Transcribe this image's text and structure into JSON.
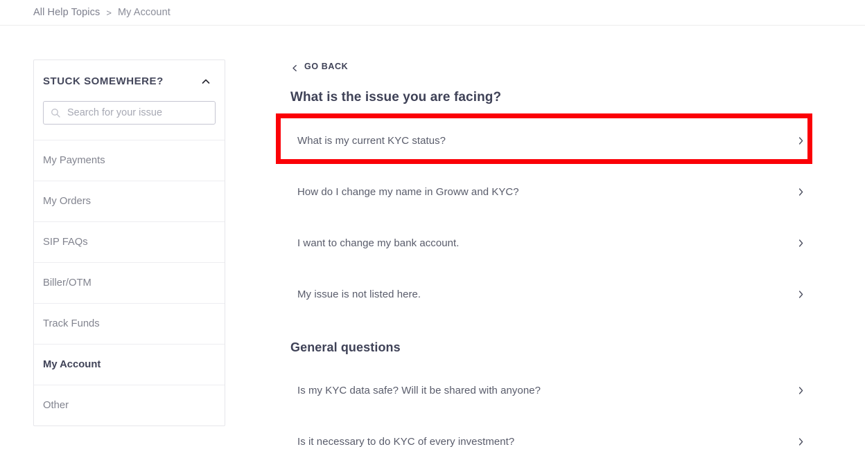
{
  "breadcrumb": {
    "root": "All Help Topics",
    "separator": ">",
    "current": "My Account"
  },
  "sidebar": {
    "title": "STUCK SOMEWHERE?",
    "collapse_icon": "chevron-up-icon",
    "search": {
      "icon": "search-icon",
      "placeholder": "Search for your issue",
      "value": ""
    },
    "items": [
      {
        "label": "My Payments",
        "active": false
      },
      {
        "label": "My Orders",
        "active": false
      },
      {
        "label": "SIP FAQs",
        "active": false
      },
      {
        "label": "Biller/OTM",
        "active": false
      },
      {
        "label": "Track Funds",
        "active": false
      },
      {
        "label": "My Account",
        "active": true
      },
      {
        "label": "Other",
        "active": false
      }
    ]
  },
  "main": {
    "go_back": {
      "label": "GO BACK",
      "icon": "chevron-left-icon"
    },
    "issue_heading": "What is the issue you are facing?",
    "issues": [
      {
        "label": "What is my current KYC status?",
        "icon": "chevron-right-icon"
      },
      {
        "label": "How do I change my name in Groww and KYC?",
        "icon": "chevron-right-icon"
      },
      {
        "label": "I want to change my bank account.",
        "icon": "chevron-right-icon"
      },
      {
        "label": "My issue is not listed here.",
        "icon": "chevron-right-icon"
      }
    ],
    "general_heading": "General questions",
    "general_questions": [
      {
        "label": "Is my KYC data safe? Will it be shared with anyone?",
        "icon": "chevron-right-icon"
      },
      {
        "label": "Is it necessary to do KYC of every investment?",
        "icon": "chevron-right-icon"
      }
    ]
  },
  "annotation": {
    "highlight_color": "#fb0007",
    "target": "What is my current KYC status?"
  }
}
